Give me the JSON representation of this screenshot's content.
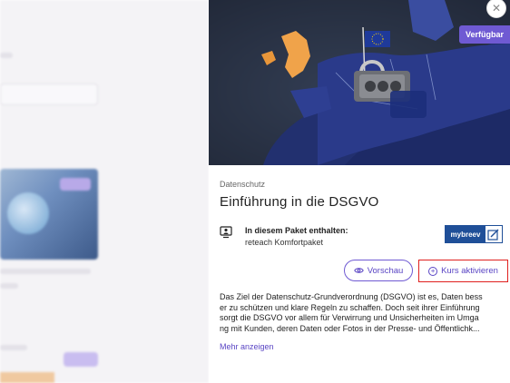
{
  "panel": {
    "badge": "Verfügbar",
    "close_icon": "close-icon",
    "category": "Datenschutz",
    "title": "Einführung in die DSGVO",
    "package": {
      "heading": "In diesem Paket enthalten:",
      "name": "reteach Komfortpaket",
      "icon": "monitor-person-icon",
      "logo_text": "mybreev"
    },
    "buttons": {
      "preview_label": "Vorschau",
      "preview_icon": "eye-icon",
      "activate_label": "Kurs aktivieren",
      "activate_icon": "plus-circle-icon"
    },
    "description_lines": [
      "Das Ziel der Datenschutz-Grundverordnung (DSGVO) ist es, Daten bess",
      "er zu schützen und klare Regeln zu schaffen. Doch seit ihrer Einführung",
      "sorgt die DSGVO vor allem für Verwirrung und Unsicherheiten im Umga",
      "ng mit Kunden, deren Daten oder Fotos in der Presse- und Öffentlichk..."
    ],
    "more_link": "Mehr anzeigen"
  },
  "colors": {
    "accent": "#6f5ad3",
    "highlight_border": "#e0201e",
    "logo_blue": "#1f4f98"
  }
}
